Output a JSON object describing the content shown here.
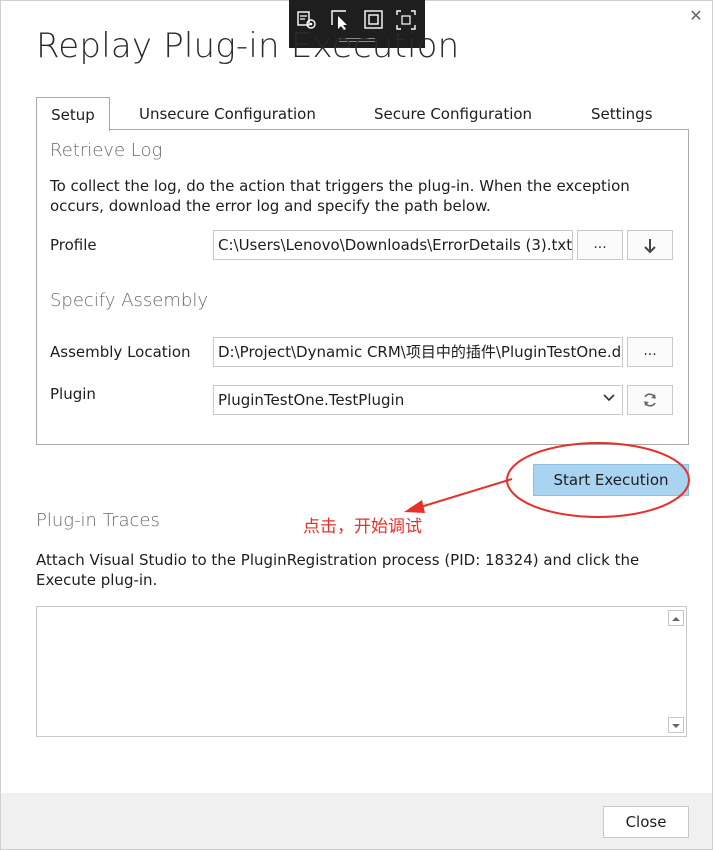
{
  "window": {
    "title": "Replay Plug-in Execution",
    "close_glyph": "✕"
  },
  "tabs": [
    {
      "label": "Setup",
      "active": true
    },
    {
      "label": "Unsecure Configuration",
      "active": false
    },
    {
      "label": "Secure Configuration",
      "active": false
    },
    {
      "label": "Settings",
      "active": false
    }
  ],
  "retrieve_log": {
    "heading": "Retrieve Log",
    "instructions": "To collect the log, do the action that triggers the plug-in. When the exception occurs, download the error log and specify the path below.",
    "profile_label": "Profile",
    "profile_value": "C:\\Users\\Lenovo\\Downloads\\ErrorDetails (3).txt",
    "browse_label": "...",
    "download_icon": "download-arrow-icon"
  },
  "specify_assembly": {
    "heading": "Specify Assembly",
    "assembly_label": "Assembly Location",
    "assembly_value": "D:\\Project\\Dynamic CRM\\项目中的插件\\PluginTestOne.dl",
    "browse_label": "...",
    "plugin_label": "Plugin",
    "plugin_value": "PluginTestOne.TestPlugin",
    "refresh_icon": "refresh-icon"
  },
  "start_button": "Start Execution",
  "annotation": {
    "text": "点击，开始调试",
    "color": "#e8302c"
  },
  "plugin_traces": {
    "heading": "Plug-in Traces",
    "instructions": "Attach Visual Studio to the PluginRegistration process (PID: 18324) and click the Execute plug-in."
  },
  "footer": {
    "close_label": "Close"
  },
  "colors": {
    "accent_button": "#a8d3f1",
    "annotation_red": "#e8302c",
    "footer_bg": "#f0f0f0"
  }
}
